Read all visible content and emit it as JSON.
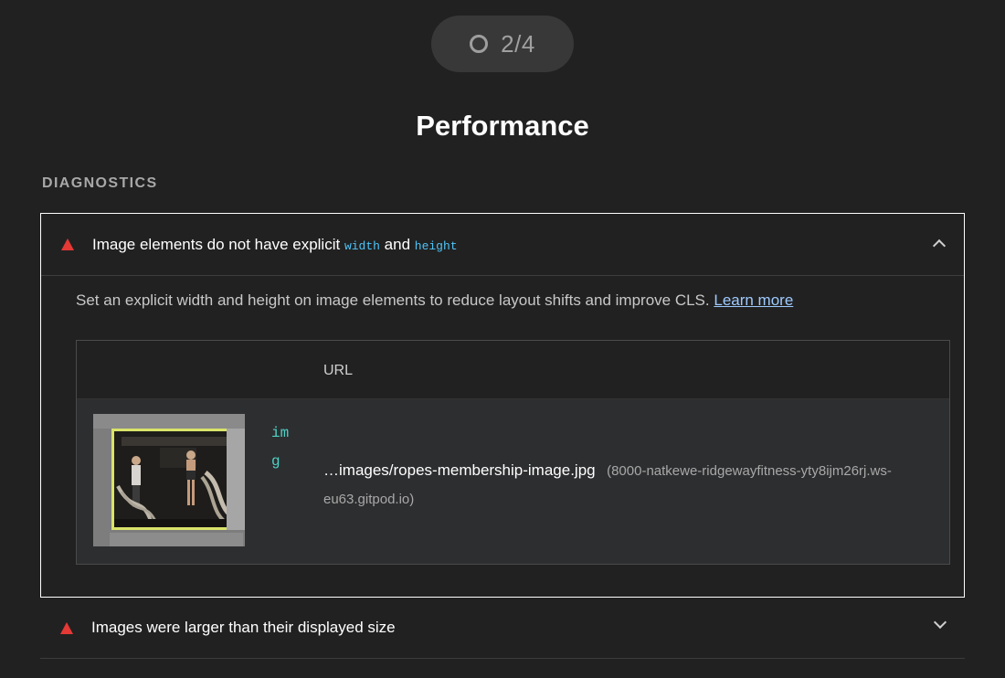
{
  "gauge": {
    "score_text": "2/4"
  },
  "category": {
    "title": "Performance"
  },
  "group": {
    "title": "DIAGNOSTICS"
  },
  "audits": [
    {
      "title_prefix": "Image elements do not have explicit ",
      "code_1": "width",
      "title_middle": " and ",
      "code_2": "height",
      "status": "fail",
      "expanded": true,
      "description": "Set an explicit width and height on image elements to reduce layout shifts and improve CLS.",
      "learn_more": "Learn more",
      "table": {
        "columns": [
          "URL"
        ],
        "rows": [
          {
            "node": "img",
            "url": "…images/ropes-membership-image.jpg",
            "origin": "(8000-natkewe-ridgewayfitness-yty8ijm26rj.ws-eu63.gitpod.io)"
          }
        ]
      }
    },
    {
      "title": "Images were larger than their displayed size",
      "status": "fail",
      "expanded": false
    }
  ],
  "colors": {
    "background": "#212121",
    "fail": "#e53935",
    "code": "#4fc3f7",
    "node": "#4fd1c5",
    "link": "#9ecbff",
    "highlight": "#d9e36a"
  }
}
